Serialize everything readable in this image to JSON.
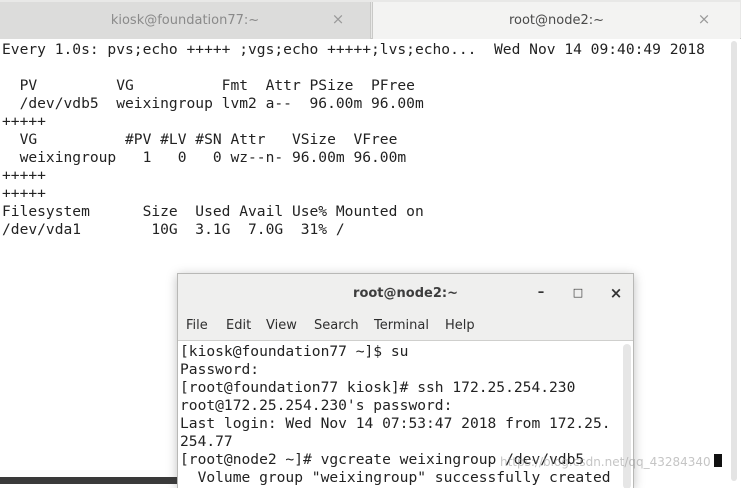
{
  "tabs": [
    {
      "label": "kiosk@foundation77:~",
      "close": "×"
    },
    {
      "label": "root@node2:~",
      "close": "×"
    }
  ],
  "outer_terminal": {
    "lines": [
      "Every 1.0s: pvs;echo +++++ ;vgs;echo +++++;lvs;echo...  Wed Nov 14 09:40:49 2018",
      "",
      "  PV         VG          Fmt  Attr PSize  PFree",
      "  /dev/vdb5  weixingroup lvm2 a--  96.00m 96.00m",
      "+++++",
      "  VG          #PV #LV #SN Attr   VSize  VFree",
      "  weixingroup   1   0   0 wz--n- 96.00m 96.00m",
      "+++++",
      "+++++",
      "Filesystem      Size  Used Avail Use% Mounted on",
      "/dev/vda1        10G  3.1G  7.0G  31% /"
    ]
  },
  "inner_window": {
    "title": "root@node2:~",
    "controls": {
      "minimize": "–",
      "maximize": "□",
      "close": "×"
    },
    "menu": [
      "File",
      "Edit",
      "View",
      "Search",
      "Terminal",
      "Help"
    ],
    "lines": [
      "[kiosk@foundation77 ~]$ su",
      "Password:",
      "[root@foundation77 kiosk]# ssh 172.25.254.230",
      "root@172.25.254.230's password:",
      "Last login: Wed Nov 14 07:53:47 2018 from 172.25.",
      "254.77",
      "[root@node2 ~]# vgcreate weixingroup /dev/vdb5",
      "  Volume group \"weixingroup\" successfully created"
    ]
  },
  "watermark": "https://blog.csdn.net/qq_43284340"
}
